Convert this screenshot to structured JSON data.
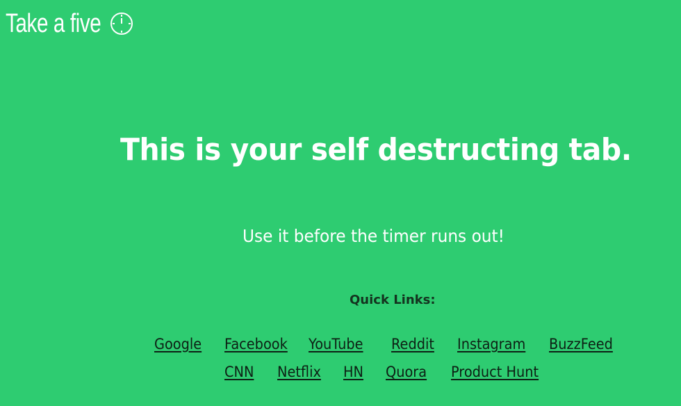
{
  "brand": {
    "title": "Take a five",
    "icon": "timer-icon"
  },
  "main": {
    "headline": "This is your self destructing tab.",
    "subline": "Use it before the timer runs out!"
  },
  "quick_links": {
    "title": "Quick Links:",
    "row1": [
      "Google",
      "Facebook",
      "YouTube",
      "Reddit",
      "Instagram",
      "BuzzFeed"
    ],
    "row2": [
      "CNN",
      "Netflix",
      "HN",
      "Quora",
      "Product Hunt"
    ]
  },
  "colors": {
    "background": "#2ecc71",
    "text_primary": "#ffffff",
    "text_dark": "#0d1f14"
  }
}
